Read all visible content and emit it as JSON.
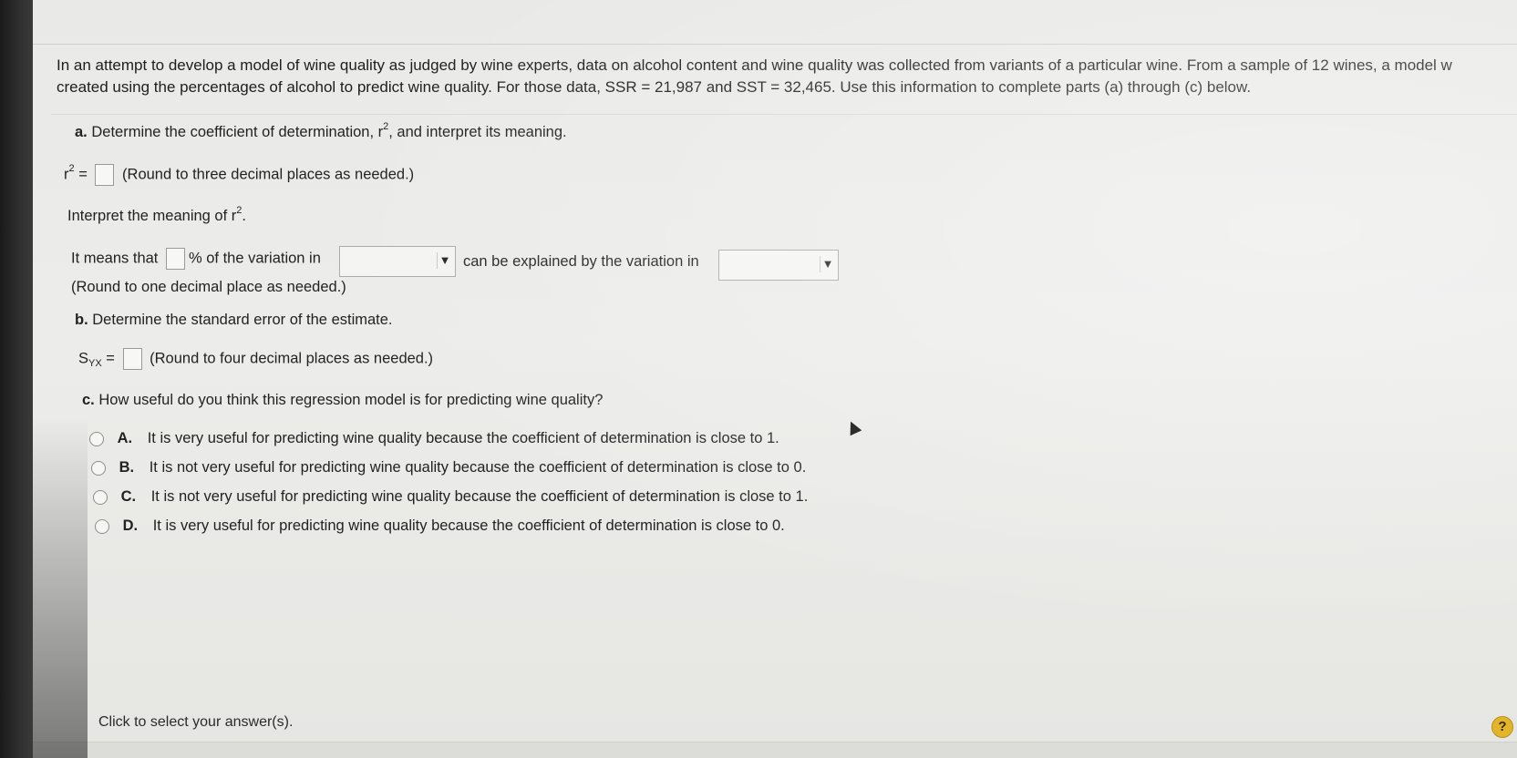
{
  "problem": {
    "intro_line1": "In an attempt to develop a model of wine quality as judged by wine experts, data on alcohol content and wine quality was collected from variants of a particular wine. From a sample of 12 wines, a model w",
    "intro_line2": "created using the percentages of alcohol to predict wine quality. For those data, SSR = 21,987 and SST = 32,465. Use this information to complete parts (a) through (c) below."
  },
  "part_a": {
    "letter": "a.",
    "prompt": "Determine the coefficient of determination, r",
    "prompt_sup": "2",
    "prompt_tail": ", and interpret its meaning.",
    "r2_label": "r",
    "r2_sup": "2",
    "r2_eq": "=",
    "r2_value": "",
    "r2_hint": "(Round to three decimal places as needed.)",
    "interpret_label": "Interpret the meaning of r",
    "interpret_sup": "2",
    "interpret_tail": ".",
    "means_prefix": "It means that",
    "means_percent": "% of the variation in",
    "dropdown1_value": "",
    "means_mid": "can be explained by the variation in",
    "dropdown2_value": "",
    "means_hint": "(Round to one decimal place as needed.)"
  },
  "part_b": {
    "letter": "b.",
    "prompt": "Determine the standard error of the estimate.",
    "syx_label": "S",
    "syx_sub": "YX",
    "syx_eq": "=",
    "syx_hint": "(Round to four decimal places as needed.)"
  },
  "part_c": {
    "letter": "c.",
    "prompt": "How useful do you think this regression model is for predicting wine quality?",
    "options": [
      {
        "letter": "A.",
        "text": "It is very useful for predicting wine quality because the coefficient of determination is close to 1."
      },
      {
        "letter": "B.",
        "text": "It is not very useful for predicting wine quality because the coefficient of determination is close to 0."
      },
      {
        "letter": "C.",
        "text": "It is not very useful for predicting wine quality because the coefficient of determination is close to 1."
      },
      {
        "letter": "D.",
        "text": "It is very useful for predicting wine quality because the coefficient of determination is close to 0."
      }
    ]
  },
  "footer": {
    "instruction": "Click to select your answer(s).",
    "help_label": "?"
  },
  "colors": {
    "screen_bg": "#ececea",
    "help_badge": "#e2b52b",
    "text": "#222222"
  }
}
